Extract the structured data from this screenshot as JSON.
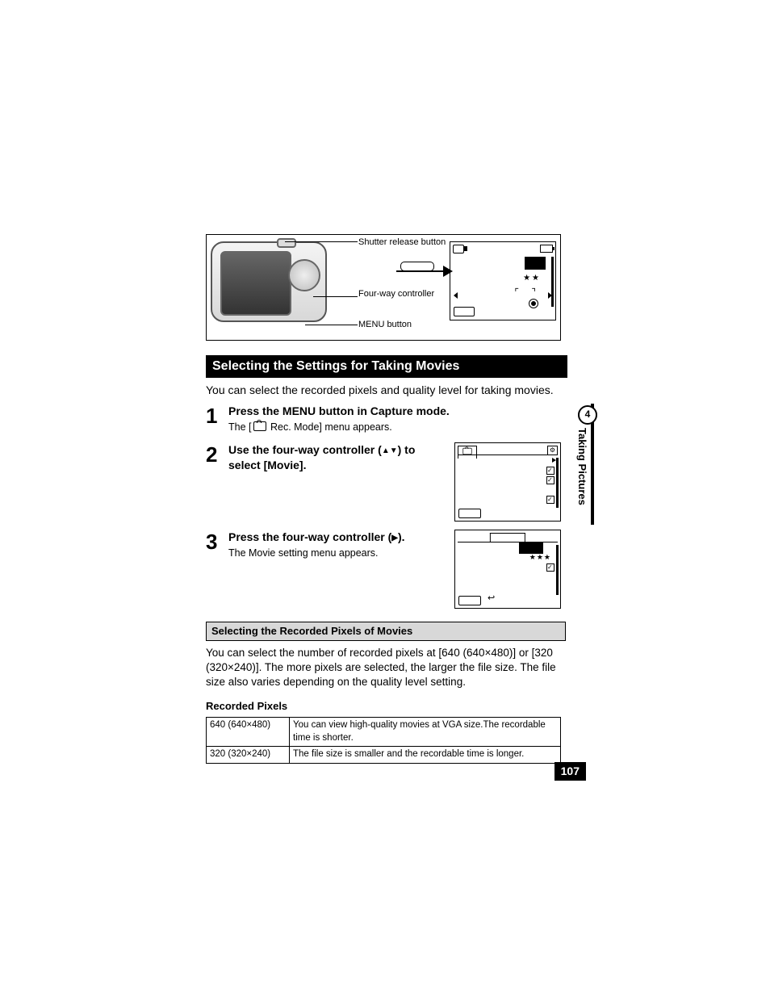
{
  "page_number": "107",
  "side_tab": {
    "number": "4",
    "label": "Taking Pictures"
  },
  "callouts": {
    "shutter": "Shutter release button",
    "fourway": "Four-way controller",
    "menu": "MENU button"
  },
  "lcd_stars": "★★",
  "section_title": "Selecting the Settings for Taking Movies",
  "intro": "You can select the recorded pixels and quality level for taking movies.",
  "steps": [
    {
      "num": "1",
      "title": "Press the MENU button in Capture mode.",
      "text_before": "The [",
      "text_after": " Rec. Mode] menu appears."
    },
    {
      "num": "2",
      "title_before": "Use the four-way controller (",
      "title_arrows": "▲▼",
      "title_after": ") to select [Movie]."
    },
    {
      "num": "3",
      "title_before": "Press the four-way controller (",
      "title_arrows": "▶",
      "title_after": ").",
      "text": "The Movie setting menu appears."
    }
  ],
  "sub_section": "Selecting the Recorded Pixels of Movies",
  "sub_intro": "You can select the number of recorded pixels at [640 (640×480)] or [320 (320×240)]. The more pixels are selected, the larger the file size. The file size also varies depending on the quality level setting.",
  "pixels_heading": "Recorded Pixels",
  "pixels_table": [
    {
      "k": "640 (640×480)",
      "v": "You can view high-quality movies at VGA size.The recordable time is shorter."
    },
    {
      "k": "320 (320×240)",
      "v": "The file size is smaller and the recordable time is longer."
    }
  ],
  "screen3_stars": "★★★"
}
